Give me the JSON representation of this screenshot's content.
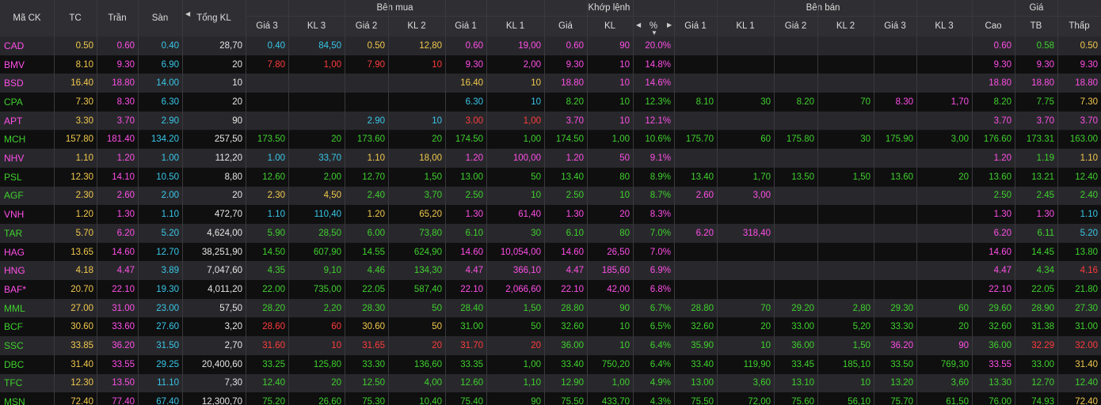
{
  "colors": {
    "ref": "#f2c94c",
    "ceil": "#ff4ee6",
    "floor": "#38c7e8",
    "up": "#3fd12c",
    "down": "#ff3b3b",
    "header_bg": "#2f2f33",
    "row_dark": "#0f0f10",
    "row_light": "#28282c"
  },
  "header": {
    "symbol": "Mã CK",
    "ref": "TC",
    "ceil": "Trần",
    "floor": "Sàn",
    "total_vol": "Tổng KL",
    "buy_group": "Bên mua",
    "match_group": "Khớp lệnh",
    "sell_group": "Bên bán",
    "price_group": "Giá",
    "bid3": "Giá 3",
    "bv3": "KL 3",
    "bid2": "Giá 2",
    "bv2": "KL 2",
    "bid1": "Giá 1",
    "bv1": "KL 1",
    "match_price": "Giá",
    "match_vol": "KL",
    "match_pct": "%",
    "ask1": "Giá 1",
    "av1": "KL 1",
    "ask2": "Giá 2",
    "av2": "KL 2",
    "ask3": "Giá 3",
    "av3": "KL 3",
    "high": "Cao",
    "avg": "TB",
    "low": "Thấp"
  },
  "rows": [
    {
      "sym": "CAD",
      "tc": "0.50",
      "tran": "0.60",
      "san": "0.40",
      "tkl": "28,70",
      "bid3": "0.40",
      "bv3": "84,50",
      "bid2": "0.50",
      "bv2": "12,80",
      "bid1": "0.60",
      "bv1": "19,00",
      "mp": "0.60",
      "mv": "90",
      "pct": "20.0%",
      "ask1": "",
      "av1": "",
      "ask2": "",
      "av2": "",
      "ask3": "",
      "av3": "",
      "hi": "0.60",
      "avg": "0.58",
      "lo": "0.50",
      "c": {
        "sym": "ceil",
        "bid3": "floor",
        "bv3": "floor",
        "bid2": "ref",
        "bv2": "ref",
        "bid1": "ceil",
        "bv1": "ceil",
        "mp": "ceil",
        "mv": "ceil",
        "pct": "ceil",
        "hi": "ceil",
        "avg": "up",
        "lo": "ref"
      }
    },
    {
      "sym": "BMV",
      "tc": "8.10",
      "tran": "9.30",
      "san": "6.90",
      "tkl": "20",
      "bid3": "7.80",
      "bv3": "1,00",
      "bid2": "7.90",
      "bv2": "10",
      "bid1": "9.30",
      "bv1": "2,00",
      "mp": "9.30",
      "mv": "10",
      "pct": "14.8%",
      "ask1": "",
      "av1": "",
      "ask2": "",
      "av2": "",
      "ask3": "",
      "av3": "",
      "hi": "9.30",
      "avg": "9.30",
      "lo": "9.30",
      "c": {
        "sym": "ceil",
        "bid3": "down",
        "bv3": "down",
        "bid2": "down",
        "bv2": "down",
        "bid1": "ceil",
        "bv1": "ceil",
        "mp": "ceil",
        "mv": "ceil",
        "pct": "ceil",
        "hi": "ceil",
        "avg": "ceil",
        "lo": "ceil"
      }
    },
    {
      "sym": "BSD",
      "tc": "16.40",
      "tran": "18.80",
      "san": "14.00",
      "tkl": "10",
      "bid3": "",
      "bv3": "",
      "bid2": "",
      "bv2": "",
      "bid1": "16.40",
      "bv1": "10",
      "mp": "18.80",
      "mv": "10",
      "pct": "14.6%",
      "ask1": "",
      "av1": "",
      "ask2": "",
      "av2": "",
      "ask3": "",
      "av3": "",
      "hi": "18.80",
      "avg": "18.80",
      "lo": "18.80",
      "c": {
        "sym": "ceil",
        "bid1": "ref",
        "bv1": "ref",
        "mp": "ceil",
        "mv": "ceil",
        "pct": "ceil",
        "hi": "ceil",
        "avg": "ceil",
        "lo": "ceil"
      }
    },
    {
      "sym": "CPA",
      "tc": "7.30",
      "tran": "8.30",
      "san": "6.30",
      "tkl": "20",
      "bid3": "",
      "bv3": "",
      "bid2": "",
      "bv2": "",
      "bid1": "6.30",
      "bv1": "10",
      "mp": "8.20",
      "mv": "10",
      "pct": "12.3%",
      "ask1": "8.10",
      "av1": "30",
      "ask2": "8.20",
      "av2": "70",
      "ask3": "8.30",
      "av3": "1,70",
      "hi": "8.20",
      "avg": "7.75",
      "lo": "7.30",
      "c": {
        "sym": "up",
        "bid1": "floor",
        "bv1": "floor",
        "mp": "up",
        "mv": "up",
        "pct": "up",
        "ask1": "up",
        "av1": "up",
        "ask2": "up",
        "av2": "up",
        "ask3": "ceil",
        "av3": "ceil",
        "hi": "up",
        "avg": "up",
        "lo": "ref"
      }
    },
    {
      "sym": "APT",
      "tc": "3.30",
      "tran": "3.70",
      "san": "2.90",
      "tkl": "90",
      "bid3": "",
      "bv3": "",
      "bid2": "2.90",
      "bv2": "10",
      "bid1": "3.00",
      "bv1": "1,00",
      "mp": "3.70",
      "mv": "10",
      "pct": "12.1%",
      "ask1": "",
      "av1": "",
      "ask2": "",
      "av2": "",
      "ask3": "",
      "av3": "",
      "hi": "3.70",
      "avg": "3.70",
      "lo": "3.70",
      "c": {
        "sym": "ceil",
        "bid2": "floor",
        "bv2": "floor",
        "bid1": "down",
        "bv1": "down",
        "mp": "ceil",
        "mv": "ceil",
        "pct": "ceil",
        "hi": "ceil",
        "avg": "ceil",
        "lo": "ceil"
      }
    },
    {
      "sym": "MCH",
      "tc": "157.80",
      "tran": "181.40",
      "san": "134.20",
      "tkl": "257,50",
      "bid3": "173.50",
      "bv3": "20",
      "bid2": "173.60",
      "bv2": "20",
      "bid1": "174.50",
      "bv1": "1,00",
      "mp": "174.50",
      "mv": "1,00",
      "pct": "10.6%",
      "ask1": "175.70",
      "av1": "60",
      "ask2": "175.80",
      "av2": "30",
      "ask3": "175.90",
      "av3": "3,00",
      "hi": "176.60",
      "avg": "173.31",
      "lo": "163.00",
      "c": {
        "sym": "up",
        "bid3": "up",
        "bv3": "up",
        "bid2": "up",
        "bv2": "up",
        "bid1": "up",
        "bv1": "up",
        "mp": "up",
        "mv": "up",
        "pct": "up",
        "ask1": "up",
        "av1": "up",
        "ask2": "up",
        "av2": "up",
        "ask3": "up",
        "av3": "up",
        "hi": "up",
        "avg": "up",
        "lo": "up"
      }
    },
    {
      "sym": "NHV",
      "tc": "1.10",
      "tran": "1.20",
      "san": "1.00",
      "tkl": "112,20",
      "bid3": "1.00",
      "bv3": "33,70",
      "bid2": "1.10",
      "bv2": "18,00",
      "bid1": "1.20",
      "bv1": "100,00",
      "mp": "1.20",
      "mv": "50",
      "pct": "9.1%",
      "ask1": "",
      "av1": "",
      "ask2": "",
      "av2": "",
      "ask3": "",
      "av3": "",
      "hi": "1.20",
      "avg": "1.19",
      "lo": "1.10",
      "c": {
        "sym": "ceil",
        "bid3": "floor",
        "bv3": "floor",
        "bid2": "ref",
        "bv2": "ref",
        "bid1": "ceil",
        "bv1": "ceil",
        "mp": "ceil",
        "mv": "ceil",
        "pct": "ceil",
        "hi": "ceil",
        "avg": "up",
        "lo": "ref"
      }
    },
    {
      "sym": "PSL",
      "tc": "12.30",
      "tran": "14.10",
      "san": "10.50",
      "tkl": "8,80",
      "bid3": "12.60",
      "bv3": "2,00",
      "bid2": "12.70",
      "bv2": "1,50",
      "bid1": "13.00",
      "bv1": "50",
      "mp": "13.40",
      "mv": "80",
      "pct": "8.9%",
      "ask1": "13.40",
      "av1": "1,70",
      "ask2": "13.50",
      "av2": "1,50",
      "ask3": "13.60",
      "av3": "20",
      "hi": "13.60",
      "avg": "13.21",
      "lo": "12.40",
      "c": {
        "sym": "up",
        "bid3": "up",
        "bv3": "up",
        "bid2": "up",
        "bv2": "up",
        "bid1": "up",
        "bv1": "up",
        "mp": "up",
        "mv": "up",
        "pct": "up",
        "ask1": "up",
        "av1": "up",
        "ask2": "up",
        "av2": "up",
        "ask3": "up",
        "av3": "up",
        "hi": "up",
        "avg": "up",
        "lo": "up"
      }
    },
    {
      "sym": "AGF",
      "tc": "2.30",
      "tran": "2.60",
      "san": "2.00",
      "tkl": "20",
      "bid3": "2.30",
      "bv3": "4,50",
      "bid2": "2.40",
      "bv2": "3,70",
      "bid1": "2.50",
      "bv1": "10",
      "mp": "2.50",
      "mv": "10",
      "pct": "8.7%",
      "ask1": "2.60",
      "av1": "3,00",
      "ask2": "",
      "av2": "",
      "ask3": "",
      "av3": "",
      "hi": "2.50",
      "avg": "2.45",
      "lo": "2.40",
      "c": {
        "sym": "up",
        "bid3": "ref",
        "bv3": "ref",
        "bid2": "up",
        "bv2": "up",
        "bid1": "up",
        "bv1": "up",
        "mp": "up",
        "mv": "up",
        "pct": "up",
        "ask1": "ceil",
        "av1": "ceil",
        "hi": "up",
        "avg": "up",
        "lo": "up"
      }
    },
    {
      "sym": "VNH",
      "tc": "1.20",
      "tran": "1.30",
      "san": "1.10",
      "tkl": "472,70",
      "bid3": "1.10",
      "bv3": "110,40",
      "bid2": "1.20",
      "bv2": "65,20",
      "bid1": "1.30",
      "bv1": "61,40",
      "mp": "1.30",
      "mv": "20",
      "pct": "8.3%",
      "ask1": "",
      "av1": "",
      "ask2": "",
      "av2": "",
      "ask3": "",
      "av3": "",
      "hi": "1.30",
      "avg": "1.30",
      "lo": "1.10",
      "c": {
        "sym": "ceil",
        "bid3": "floor",
        "bv3": "floor",
        "bid2": "ref",
        "bv2": "ref",
        "bid1": "ceil",
        "bv1": "ceil",
        "mp": "ceil",
        "mv": "ceil",
        "pct": "ceil",
        "hi": "ceil",
        "avg": "ceil",
        "lo": "floor"
      }
    },
    {
      "sym": "TAR",
      "tc": "5.70",
      "tran": "6.20",
      "san": "5.20",
      "tkl": "4,624,00",
      "bid3": "5.90",
      "bv3": "28,50",
      "bid2": "6.00",
      "bv2": "73,80",
      "bid1": "6.10",
      "bv1": "30",
      "mp": "6.10",
      "mv": "80",
      "pct": "7.0%",
      "ask1": "6.20",
      "av1": "318,40",
      "ask2": "",
      "av2": "",
      "ask3": "",
      "av3": "",
      "hi": "6.20",
      "avg": "6.11",
      "lo": "5.20",
      "c": {
        "sym": "up",
        "bid3": "up",
        "bv3": "up",
        "bid2": "up",
        "bv2": "up",
        "bid1": "up",
        "bv1": "up",
        "mp": "up",
        "mv": "up",
        "pct": "up",
        "ask1": "ceil",
        "av1": "ceil",
        "hi": "ceil",
        "avg": "up",
        "lo": "floor"
      }
    },
    {
      "sym": "HAG",
      "tc": "13.65",
      "tran": "14.60",
      "san": "12.70",
      "tkl": "38,251,90",
      "bid3": "14.50",
      "bv3": "607,90",
      "bid2": "14.55",
      "bv2": "624,90",
      "bid1": "14.60",
      "bv1": "10,054,00",
      "mp": "14.60",
      "mv": "26,50",
      "pct": "7.0%",
      "ask1": "",
      "av1": "",
      "ask2": "",
      "av2": "",
      "ask3": "",
      "av3": "",
      "hi": "14.60",
      "avg": "14.45",
      "lo": "13.80",
      "c": {
        "sym": "ceil",
        "bid3": "up",
        "bv3": "up",
        "bid2": "up",
        "bv2": "up",
        "bid1": "ceil",
        "bv1": "ceil",
        "mp": "ceil",
        "mv": "ceil",
        "pct": "ceil",
        "hi": "ceil",
        "avg": "up",
        "lo": "up"
      }
    },
    {
      "sym": "HNG",
      "tc": "4.18",
      "tran": "4.47",
      "san": "3.89",
      "tkl": "7,047,60",
      "bid3": "4.35",
      "bv3": "9,10",
      "bid2": "4.46",
      "bv2": "134,30",
      "bid1": "4.47",
      "bv1": "366,10",
      "mp": "4.47",
      "mv": "185,60",
      "pct": "6.9%",
      "ask1": "",
      "av1": "",
      "ask2": "",
      "av2": "",
      "ask3": "",
      "av3": "",
      "hi": "4.47",
      "avg": "4.34",
      "lo": "4.16",
      "c": {
        "sym": "ceil",
        "bid3": "up",
        "bv3": "up",
        "bid2": "up",
        "bv2": "up",
        "bid1": "ceil",
        "bv1": "ceil",
        "mp": "ceil",
        "mv": "ceil",
        "pct": "ceil",
        "hi": "ceil",
        "avg": "up",
        "lo": "down"
      }
    },
    {
      "sym": "BAF*",
      "tc": "20.70",
      "tran": "22.10",
      "san": "19.30",
      "tkl": "4,011,20",
      "bid3": "22.00",
      "bv3": "735,00",
      "bid2": "22.05",
      "bv2": "587,40",
      "bid1": "22.10",
      "bv1": "2,066,60",
      "mp": "22.10",
      "mv": "42,00",
      "pct": "6.8%",
      "ask1": "",
      "av1": "",
      "ask2": "",
      "av2": "",
      "ask3": "",
      "av3": "",
      "hi": "22.10",
      "avg": "22.05",
      "lo": "21.80",
      "c": {
        "sym": "ceil",
        "bid3": "up",
        "bv3": "up",
        "bid2": "up",
        "bv2": "up",
        "bid1": "ceil",
        "bv1": "ceil",
        "mp": "ceil",
        "mv": "ceil",
        "pct": "ceil",
        "hi": "ceil",
        "avg": "up",
        "lo": "up"
      }
    },
    {
      "sym": "MML",
      "tc": "27.00",
      "tran": "31.00",
      "san": "23.00",
      "tkl": "57,50",
      "bid3": "28.20",
      "bv3": "2,20",
      "bid2": "28.30",
      "bv2": "50",
      "bid1": "28.40",
      "bv1": "1,50",
      "mp": "28.80",
      "mv": "90",
      "pct": "6.7%",
      "ask1": "28.80",
      "av1": "70",
      "ask2": "29.20",
      "av2": "2,80",
      "ask3": "29.30",
      "av3": "60",
      "hi": "29.60",
      "avg": "28.90",
      "lo": "27.30",
      "c": {
        "sym": "up",
        "bid3": "up",
        "bv3": "up",
        "bid2": "up",
        "bv2": "up",
        "bid1": "up",
        "bv1": "up",
        "mp": "up",
        "mv": "up",
        "pct": "up",
        "ask1": "up",
        "av1": "up",
        "ask2": "up",
        "av2": "up",
        "ask3": "up",
        "av3": "up",
        "hi": "up",
        "avg": "up",
        "lo": "up"
      }
    },
    {
      "sym": "BCF",
      "tc": "30.60",
      "tran": "33.60",
      "san": "27.60",
      "tkl": "3,20",
      "bid3": "28.60",
      "bv3": "60",
      "bid2": "30.60",
      "bv2": "50",
      "bid1": "31.00",
      "bv1": "50",
      "mp": "32.60",
      "mv": "10",
      "pct": "6.5%",
      "ask1": "32.60",
      "av1": "20",
      "ask2": "33.00",
      "av2": "5,20",
      "ask3": "33.30",
      "av3": "20",
      "hi": "32.60",
      "avg": "31.38",
      "lo": "31.00",
      "c": {
        "sym": "up",
        "bid3": "down",
        "bv3": "down",
        "bid2": "ref",
        "bv2": "ref",
        "bid1": "up",
        "bv1": "up",
        "mp": "up",
        "mv": "up",
        "pct": "up",
        "ask1": "up",
        "av1": "up",
        "ask2": "up",
        "av2": "up",
        "ask3": "up",
        "av3": "up",
        "hi": "up",
        "avg": "up",
        "lo": "up"
      }
    },
    {
      "sym": "SSC",
      "tc": "33.85",
      "tran": "36.20",
      "san": "31.50",
      "tkl": "2,70",
      "bid3": "31.60",
      "bv3": "10",
      "bid2": "31.65",
      "bv2": "20",
      "bid1": "31.70",
      "bv1": "20",
      "mp": "36.00",
      "mv": "10",
      "pct": "6.4%",
      "ask1": "35.90",
      "av1": "10",
      "ask2": "36.00",
      "av2": "1,50",
      "ask3": "36.20",
      "av3": "90",
      "hi": "36.00",
      "avg": "32.29",
      "lo": "32.00",
      "c": {
        "sym": "up",
        "bid3": "down",
        "bv3": "down",
        "bid2": "down",
        "bv2": "down",
        "bid1": "down",
        "bv1": "down",
        "mp": "up",
        "mv": "up",
        "pct": "up",
        "ask1": "up",
        "av1": "up",
        "ask2": "up",
        "av2": "up",
        "ask3": "ceil",
        "av3": "ceil",
        "hi": "up",
        "avg": "down",
        "lo": "down"
      }
    },
    {
      "sym": "DBC",
      "tc": "31.40",
      "tran": "33.55",
      "san": "29.25",
      "tkl": "20,400,60",
      "bid3": "33.25",
      "bv3": "125,80",
      "bid2": "33.30",
      "bv2": "136,60",
      "bid1": "33.35",
      "bv1": "1,00",
      "mp": "33.40",
      "mv": "750,20",
      "pct": "6.4%",
      "ask1": "33.40",
      "av1": "119,90",
      "ask2": "33.45",
      "av2": "185,10",
      "ask3": "33.50",
      "av3": "769,30",
      "hi": "33.55",
      "avg": "33.00",
      "lo": "31.40",
      "c": {
        "sym": "up",
        "bid3": "up",
        "bv3": "up",
        "bid2": "up",
        "bv2": "up",
        "bid1": "up",
        "bv1": "up",
        "mp": "up",
        "mv": "up",
        "pct": "up",
        "ask1": "up",
        "av1": "up",
        "ask2": "up",
        "av2": "up",
        "ask3": "up",
        "av3": "up",
        "hi": "ceil",
        "avg": "up",
        "lo": "ref"
      }
    },
    {
      "sym": "TFC",
      "tc": "12.30",
      "tran": "13.50",
      "san": "11.10",
      "tkl": "7,30",
      "bid3": "12.40",
      "bv3": "20",
      "bid2": "12.50",
      "bv2": "4,00",
      "bid1": "12.60",
      "bv1": "1,10",
      "mp": "12.90",
      "mv": "1,00",
      "pct": "4.9%",
      "ask1": "13.00",
      "av1": "3,60",
      "ask2": "13.10",
      "av2": "10",
      "ask3": "13.20",
      "av3": "3,60",
      "hi": "13.30",
      "avg": "12.70",
      "lo": "12.40",
      "c": {
        "sym": "up",
        "bid3": "up",
        "bv3": "up",
        "bid2": "up",
        "bv2": "up",
        "bid1": "up",
        "bv1": "up",
        "mp": "up",
        "mv": "up",
        "pct": "up",
        "ask1": "up",
        "av1": "up",
        "ask2": "up",
        "av2": "up",
        "ask3": "up",
        "av3": "up",
        "hi": "up",
        "avg": "up",
        "lo": "up"
      }
    },
    {
      "sym": "MSN",
      "tc": "72.40",
      "tran": "77.40",
      "san": "67.40",
      "tkl": "12,300,70",
      "bid3": "75.20",
      "bv3": "26,60",
      "bid2": "75.30",
      "bv2": "10,40",
      "bid1": "75.40",
      "bv1": "90",
      "mp": "75.50",
      "mv": "433,70",
      "pct": "4.3%",
      "ask1": "75.50",
      "av1": "72,00",
      "ask2": "75.60",
      "av2": "56,10",
      "ask3": "75.70",
      "av3": "61,50",
      "hi": "76.00",
      "avg": "74.93",
      "lo": "72.40",
      "c": {
        "sym": "up",
        "bid3": "up",
        "bv3": "up",
        "bid2": "up",
        "bv2": "up",
        "bid1": "up",
        "bv1": "up",
        "mp": "up",
        "mv": "up",
        "pct": "up",
        "ask1": "up",
        "av1": "up",
        "ask2": "up",
        "av2": "up",
        "ask3": "up",
        "av3": "up",
        "hi": "up",
        "avg": "up",
        "lo": "ref"
      }
    }
  ]
}
